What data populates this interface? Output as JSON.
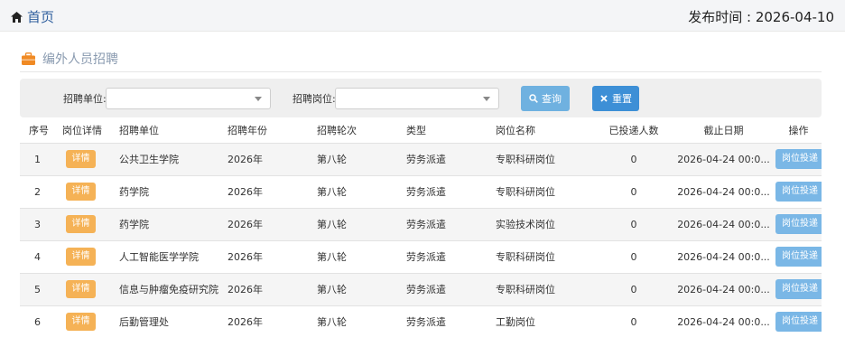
{
  "header": {
    "home_label": "首页",
    "publish_time": "发布时间 : 2026-04-10"
  },
  "section": {
    "title": "编外人员招聘"
  },
  "filters": {
    "unit_label": "招聘单位:",
    "unit_value": "",
    "position_label": "招聘岗位:",
    "position_value": "",
    "query_label": "查询",
    "reset_label": "重置"
  },
  "table": {
    "headers": [
      "序号",
      "岗位详情",
      "招聘单位",
      "招聘年份",
      "招聘轮次",
      "类型",
      "岗位名称",
      "已投递人数",
      "截止日期",
      "操作"
    ],
    "detail_label": "详情",
    "apply_label": "岗位投递",
    "rows": [
      {
        "no": "1",
        "unit": "公共卫生学院",
        "year": "2026年",
        "round": "第八轮",
        "type": "劳务派遣",
        "position": "专职科研岗位",
        "applicants": "0",
        "deadline": "2026-04-24 00:0..."
      },
      {
        "no": "2",
        "unit": "药学院",
        "year": "2026年",
        "round": "第八轮",
        "type": "劳务派遣",
        "position": "专职科研岗位",
        "applicants": "0",
        "deadline": "2026-04-24 00:0..."
      },
      {
        "no": "3",
        "unit": "药学院",
        "year": "2026年",
        "round": "第八轮",
        "type": "劳务派遣",
        "position": "实验技术岗位",
        "applicants": "0",
        "deadline": "2026-04-24 00:0..."
      },
      {
        "no": "4",
        "unit": "人工智能医学学院",
        "year": "2026年",
        "round": "第八轮",
        "type": "劳务派遣",
        "position": "专职科研岗位",
        "applicants": "0",
        "deadline": "2026-04-24 00:0..."
      },
      {
        "no": "5",
        "unit": "信息与肿瘤免疫研究院",
        "year": "2026年",
        "round": "第八轮",
        "type": "劳务派遣",
        "position": "专职科研岗位",
        "applicants": "0",
        "deadline": "2026-04-24 00:0..."
      },
      {
        "no": "6",
        "unit": "后勤管理处",
        "year": "2026年",
        "round": "第八轮",
        "type": "劳务派遣",
        "position": "工勤岗位",
        "applicants": "0",
        "deadline": "2026-04-24 00:0..."
      }
    ]
  }
}
